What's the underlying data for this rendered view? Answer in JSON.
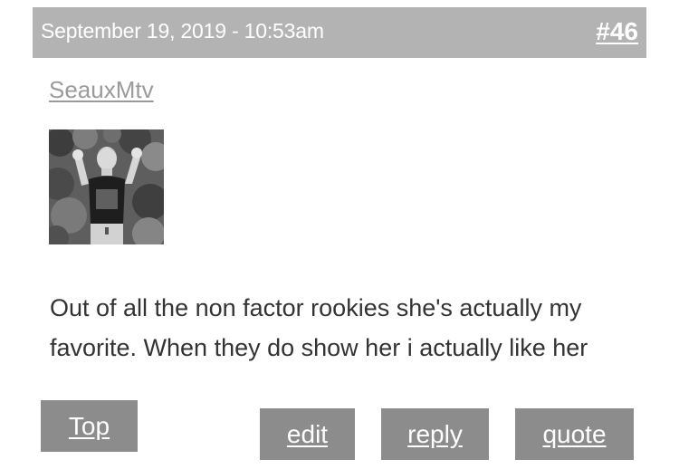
{
  "post": {
    "date": "September 19, 2019 - 10:53am",
    "number": "#46",
    "username": "SeauxMtv",
    "body": "Out of all the non factor rookies she's actually my favorite. When they do show her i actually like her"
  },
  "actions": {
    "top": "Top",
    "edit": "edit",
    "reply": "reply",
    "quote": "quote"
  },
  "colors": {
    "header_bg": "#b3b3b3",
    "button_bg": "#8c8c8c",
    "username": "#9a9a9a",
    "body_text": "#333333"
  }
}
